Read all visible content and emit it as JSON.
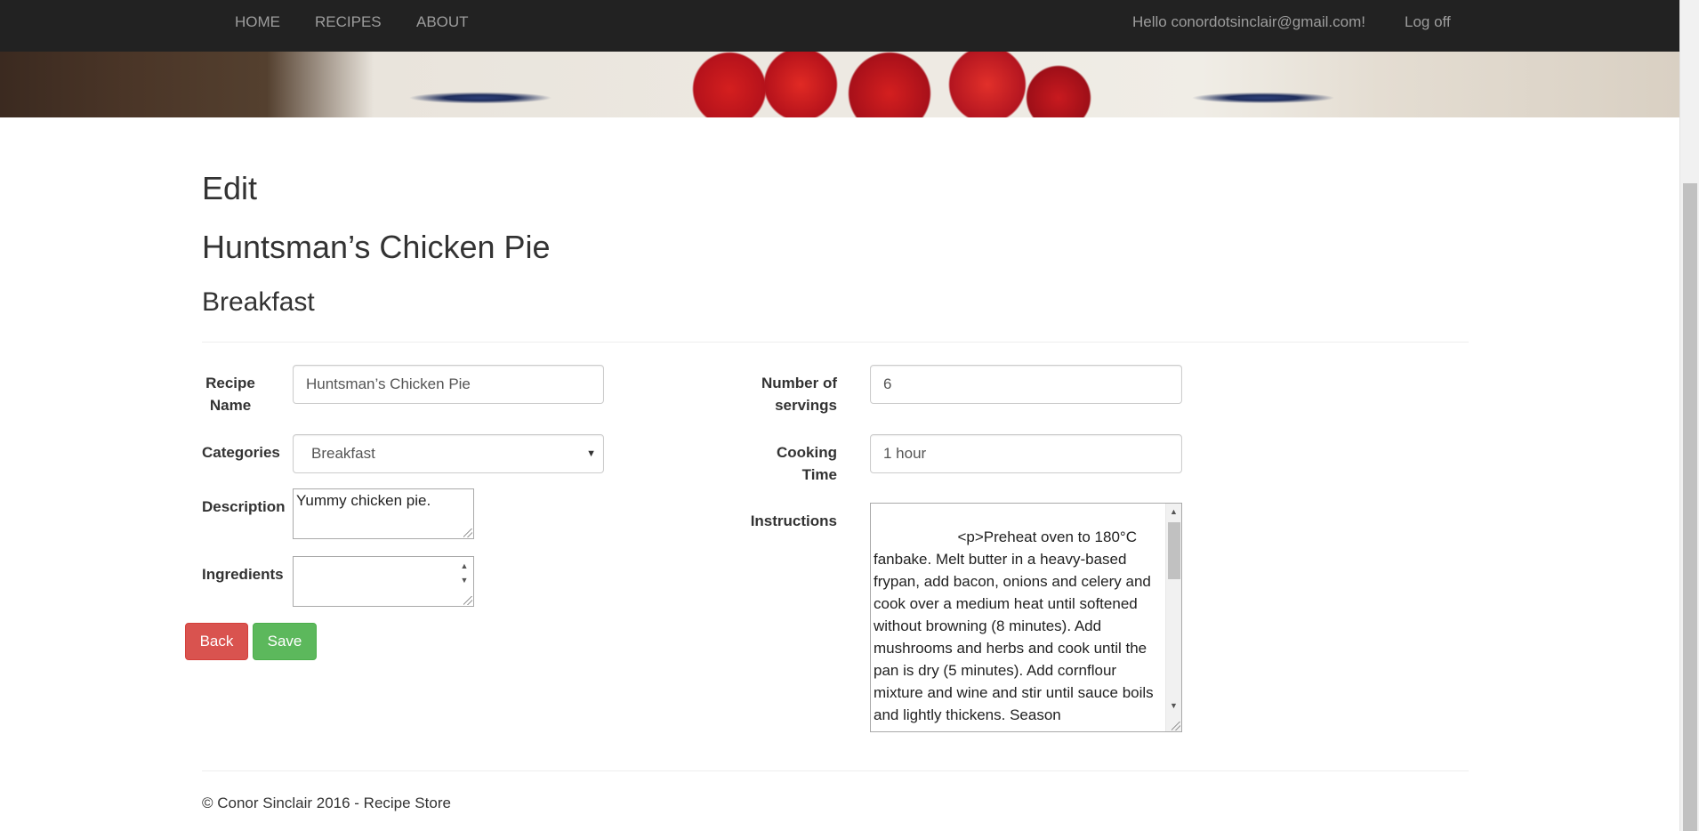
{
  "nav": {
    "home": "HOME",
    "recipes": "RECIPES",
    "about": "ABOUT",
    "greeting": "Hello conordotsinclair@gmail.com!",
    "logoff": "Log off"
  },
  "page": {
    "title": "Edit",
    "recipe_title": "Huntsman’s Chicken Pie",
    "category_title": "Breakfast"
  },
  "form": {
    "recipe_name_label": "Recipe\nName",
    "recipe_name_value": "Huntsman’s Chicken Pie",
    "categories_label": "Categories",
    "categories_value": "Breakfast",
    "description_label": "Description",
    "description_value": "Yummy chicken pie.",
    "ingredients_label": "Ingredients",
    "ingredients_value": "",
    "servings_label": "Number of\nservings",
    "servings_value": "6",
    "cooking_time_label": "Cooking\nTime",
    "cooking_time_value": "1 hour",
    "instructions_label": "Instructions",
    "instructions_value": "\n                    <p>Preheat oven to 180°C fanbake. Melt butter in a heavy-based frypan, add bacon, onions and celery and cook over a medium heat until softened without browning (8 minutes). Add mushrooms and herbs and cook until the pan is dry (5 minutes). Add cornflour mixture and wine and stir until sauce boils and lightly thickens. Season"
  },
  "buttons": {
    "back": "Back",
    "save": "Save"
  },
  "footer": {
    "text": "© Conor Sinclair 2016 - Recipe Store"
  },
  "icons": {
    "select_arrow": "caret-down-icon",
    "spinner": "spinner-arrows-icon",
    "scroll_up": "scroll-up-arrow-icon",
    "scroll_down": "scroll-down-arrow-icon",
    "resize": "resize-grip-icon"
  },
  "colors": {
    "navbar_bg": "#222222",
    "nav_text": "#9d9d9d",
    "danger": "#d9534f",
    "success": "#5cb85c"
  }
}
